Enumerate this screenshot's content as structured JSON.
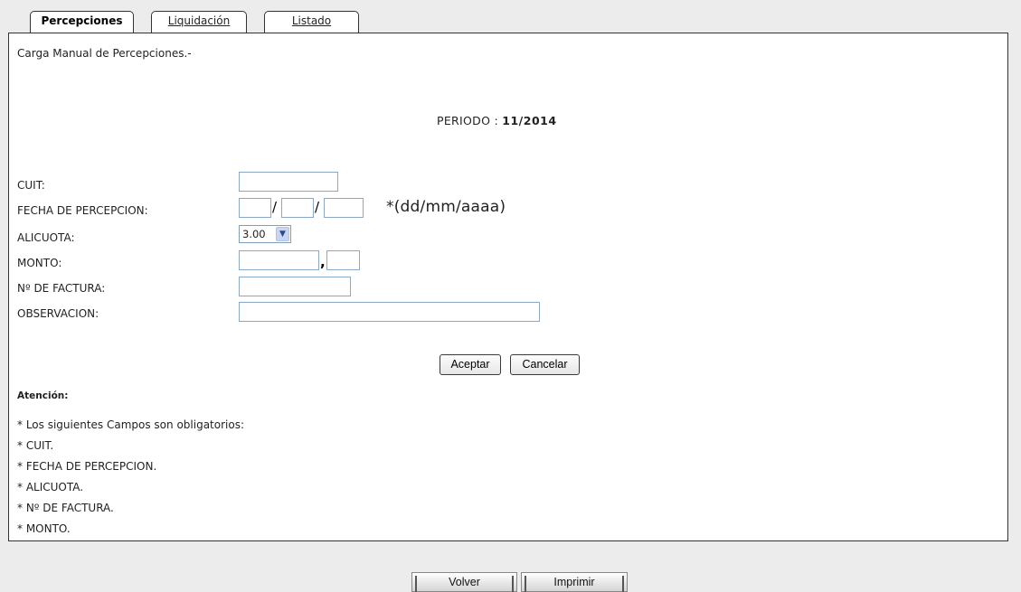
{
  "tabs": [
    {
      "label": "Percepciones",
      "active": true
    },
    {
      "label": "Liquidación",
      "active": false
    },
    {
      "label": "Listado",
      "active": false
    }
  ],
  "form": {
    "heading": "Carga Manual de Percepciones.-",
    "periodo_label": "PERIODO :",
    "periodo_value": "11/2014",
    "fields": {
      "cuit": {
        "label": "CUIT:",
        "value": ""
      },
      "fecha": {
        "label": "FECHA DE PERCEPCION:",
        "day": "",
        "month": "",
        "year": "",
        "separator": "/",
        "hint": "*(dd/mm/aaaa)"
      },
      "alicuota": {
        "label": "ALICUOTA:",
        "selected": "3.00"
      },
      "monto": {
        "label": "MONTO:",
        "integer": "",
        "decimal": "",
        "separator": ","
      },
      "factura": {
        "label": "Nº DE FACTURA:",
        "value": ""
      },
      "observacion": {
        "label": "OBSERVACION:",
        "value": ""
      }
    },
    "accept_label": "Aceptar",
    "cancel_label": "Cancelar"
  },
  "notice": {
    "title": "Atención:",
    "lines": [
      "* Los siguientes Campos son obligatorios:",
      "* CUIT.",
      "* FECHA DE PERCEPCION.",
      "* ALICUOTA.",
      "* Nº DE FACTURA.",
      "* MONTO."
    ]
  },
  "footer": {
    "back_label": "Volver",
    "print_label": "Imprimir"
  },
  "icons": {
    "dropdown": "chevron-down-icon"
  }
}
